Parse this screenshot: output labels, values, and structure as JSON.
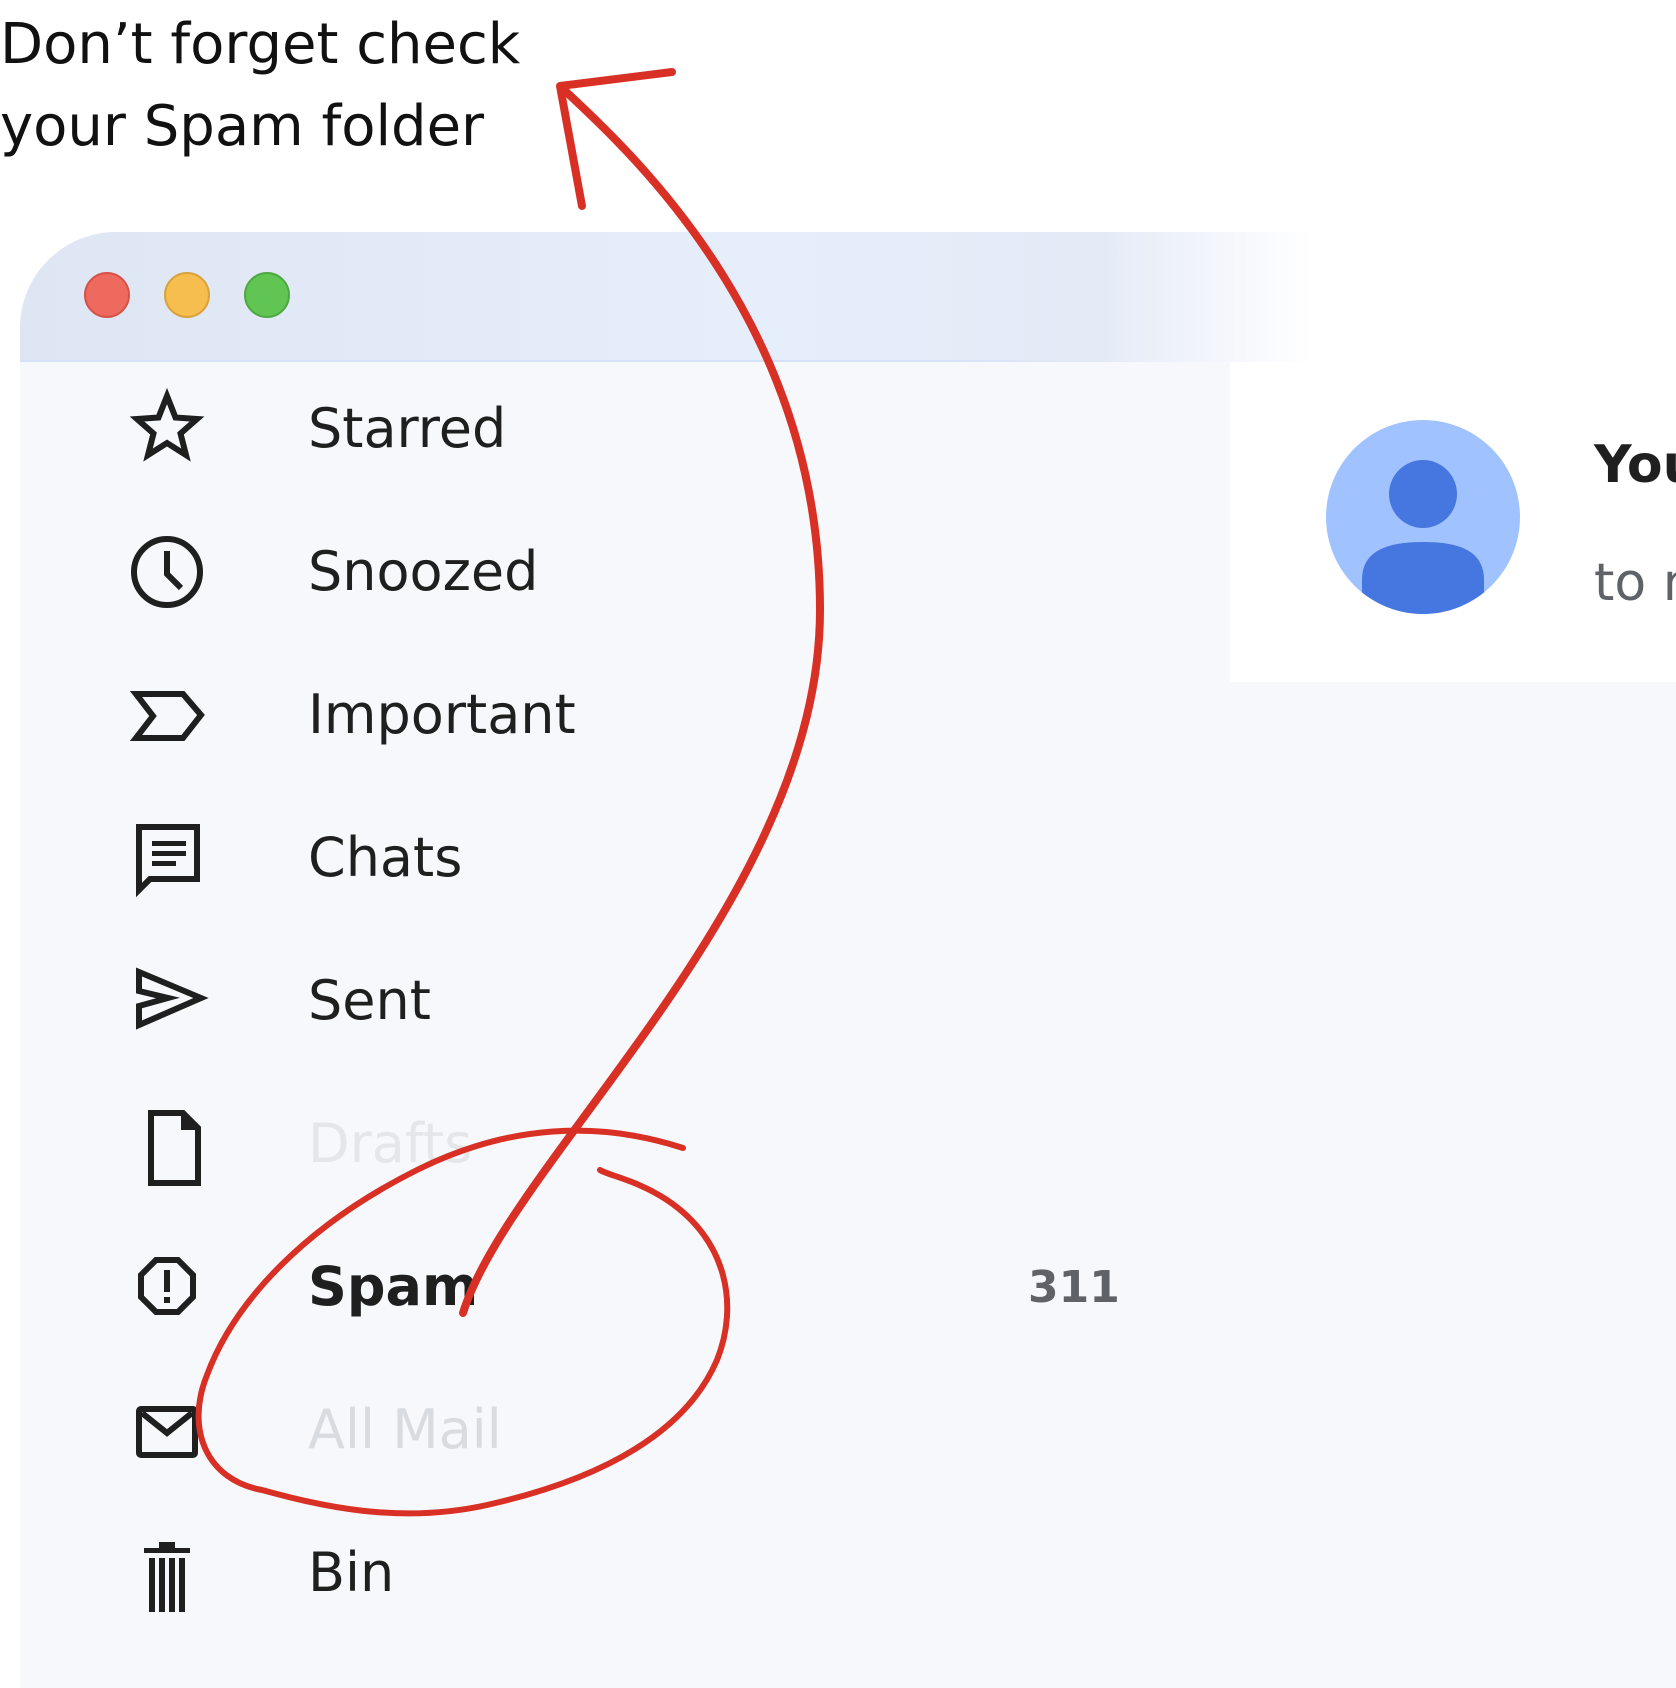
{
  "annotation": {
    "line1": "Don’t forget check",
    "line2": "your Spam folder",
    "color": "#d93025"
  },
  "window": {
    "controls": [
      "close",
      "minimize",
      "zoom"
    ]
  },
  "sidebar": {
    "items": [
      {
        "label": "Starred",
        "icon": "star-icon"
      },
      {
        "label": "Snoozed",
        "icon": "clock-icon"
      },
      {
        "label": "Important",
        "icon": "important-icon"
      },
      {
        "label": "Chats",
        "icon": "chat-icon"
      },
      {
        "label": "Sent",
        "icon": "send-icon"
      },
      {
        "label": "Drafts",
        "icon": "draft-icon"
      },
      {
        "label": "Spam",
        "icon": "spam-icon",
        "count": "311",
        "active": true
      },
      {
        "label": "All Mail",
        "icon": "mail-icon"
      },
      {
        "label": "Bin",
        "icon": "trash-icon"
      }
    ]
  },
  "email": {
    "sender": "You",
    "recipient": "to m"
  }
}
